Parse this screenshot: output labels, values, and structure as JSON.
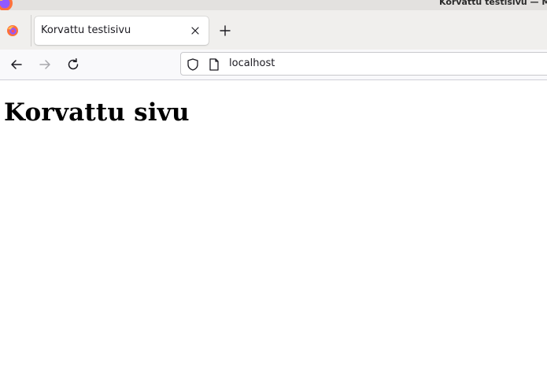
{
  "window": {
    "title": "Korvattu testisivu — M"
  },
  "tabs": [
    {
      "title": "Korvattu testisivu",
      "active": true
    }
  ],
  "toolbar": {
    "back_icon": "arrow-left-icon",
    "forward_icon": "arrow-right-icon",
    "reload_icon": "reload-icon",
    "new_tab_icon": "plus-icon"
  },
  "urlbar": {
    "value": "localhost",
    "security_icon": "shield-icon",
    "page_icon": "page-icon"
  },
  "page": {
    "heading": "Korvattu sivu"
  },
  "colors": {
    "titlebar": "#e3e1df",
    "tabstrip": "#f0efed",
    "toolbar": "#f9f9fb",
    "text": "#1c1b22"
  }
}
